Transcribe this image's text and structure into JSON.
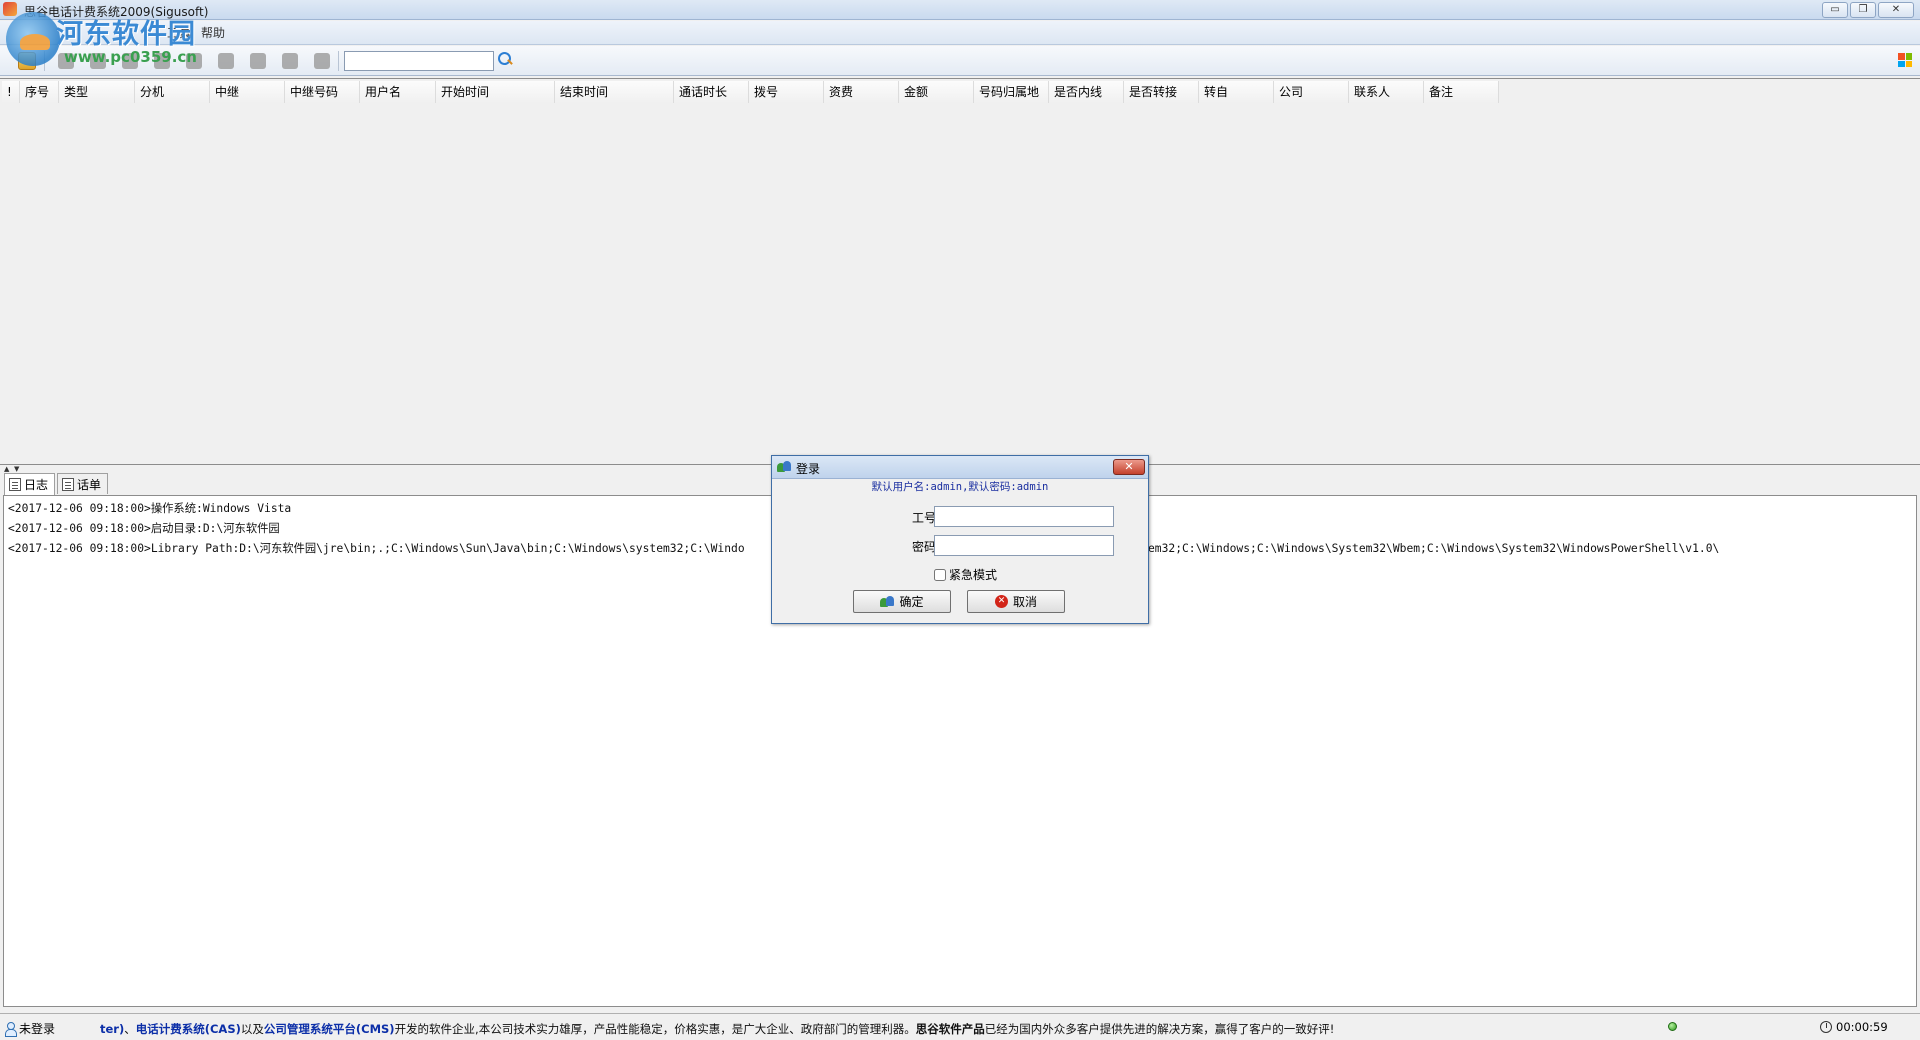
{
  "window": {
    "title": "思谷电话计费系统2009(Sigusoft)",
    "minimize": "▭",
    "restore": "❐",
    "close": "✕"
  },
  "menu": {
    "items": [
      "工具",
      "帮助"
    ]
  },
  "watermark": {
    "text": "河东软件园",
    "url": "www.pc0359.cn"
  },
  "toolbar": {
    "search_value": "",
    "search_placeholder": ""
  },
  "table": {
    "columns": [
      {
        "label": "!"
      },
      {
        "label": "序号"
      },
      {
        "label": "类型"
      },
      {
        "label": "分机"
      },
      {
        "label": "中继"
      },
      {
        "label": "中继号码"
      },
      {
        "label": "用户名"
      },
      {
        "label": "开始时间"
      },
      {
        "label": "结束时间"
      },
      {
        "label": "通话时长"
      },
      {
        "label": "拨号"
      },
      {
        "label": "资费"
      },
      {
        "label": "金额"
      },
      {
        "label": "号码归属地"
      },
      {
        "label": "是否内线"
      },
      {
        "label": "是否转接"
      },
      {
        "label": "转自"
      },
      {
        "label": "公司"
      },
      {
        "label": "联系人"
      },
      {
        "label": "备注"
      }
    ]
  },
  "tabs": {
    "log_label": "日志",
    "records_label": "话单"
  },
  "log": {
    "lines": [
      "<2017-12-06 09:18:00>操作系统:Windows Vista",
      "<2017-12-06 09:18:00>启动目录:D:\\河东软件园",
      "<2017-12-06 09:18:00>Library Path:D:\\河东软件园\\jre\\bin;.;C:\\Windows\\Sun\\Java\\bin;C:\\Windows\\system32;C:\\Windo"
    ],
    "line3_tail": "em32;C:\\Windows;C:\\Windows\\System32\\Wbem;C:\\Windows\\System32\\WindowsPowerShell\\v1.0\\"
  },
  "status": {
    "login_state": "未登录",
    "ticker": {
      "p1": "ter)",
      "p2": "、",
      "p3": "电话计费系统(CAS)",
      "p4": "以及",
      "p5": "公司管理系统平台(CMS)",
      "p6": "开发的软件企业,本公司技术实力雄厚，产品性能稳定，价格实惠，是广大企业、政府部门的管理利器。",
      "p7": "思谷软件产品",
      "p8": "已经为国内外众多客户提供先进的解决方案，赢得了客户的一致好评!"
    },
    "timer": "00:00:59"
  },
  "dialog": {
    "title": "登录",
    "hint": "默认用户名:admin,默认密码:admin",
    "id_label": "工号",
    "id_value": "",
    "password_label": "密码",
    "password_value": "",
    "emergency_label": "紧急模式",
    "emergency_checked": false,
    "ok_label": "确定",
    "cancel_label": "取消"
  }
}
